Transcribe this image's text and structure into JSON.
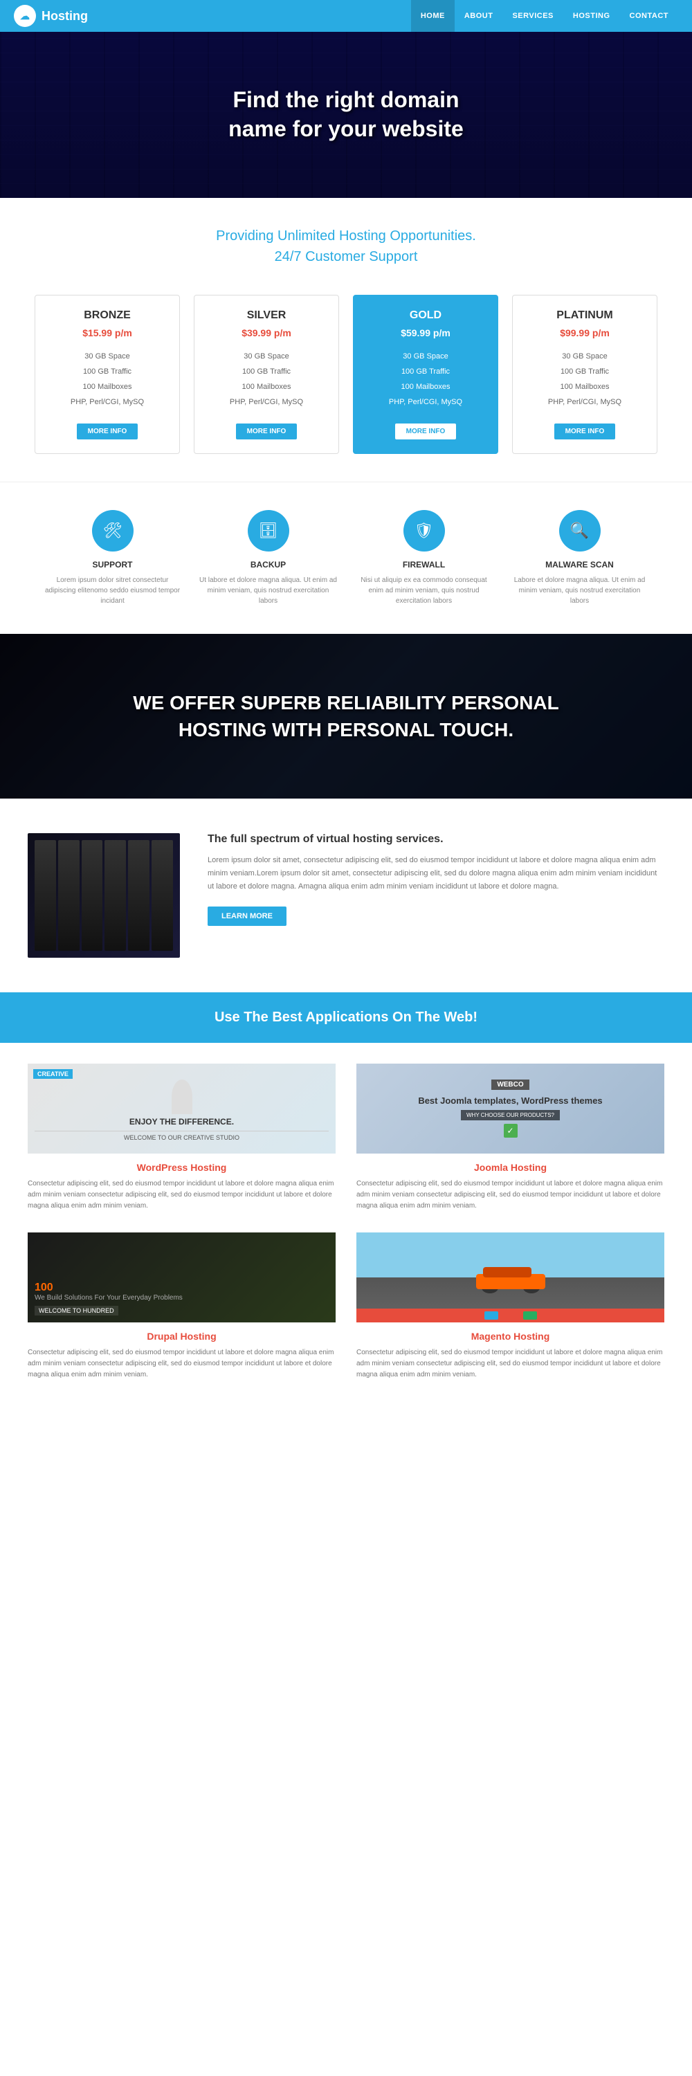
{
  "navbar": {
    "brand": "Hosting",
    "links": [
      {
        "label": "HOME",
        "active": true
      },
      {
        "label": "ABOUT",
        "active": false
      },
      {
        "label": "SERVICES",
        "active": false
      },
      {
        "label": "HOSTING",
        "active": false
      },
      {
        "label": "CONTACT",
        "active": false
      }
    ]
  },
  "hero": {
    "line1": "Find the right domain",
    "line2": "name for your website"
  },
  "tagline": {
    "line1": "Providing Unlimited Hosting Opportunities.",
    "line2": "24/7 Customer Support"
  },
  "pricing": {
    "plans": [
      {
        "name": "BRONZE",
        "price": "$15.99 p/m",
        "features": [
          "30 GB Space",
          "100 GB Traffic",
          "100 Mailboxes",
          "PHP, Perl/CGI, MySQ"
        ],
        "cta": "MORE INFO",
        "featured": false
      },
      {
        "name": "SILVER",
        "price": "$39.99 p/m",
        "features": [
          "30 GB Space",
          "100 GB Traffic",
          "100 Mailboxes",
          "PHP, Perl/CGI, MySQ"
        ],
        "cta": "MORE INFO",
        "featured": false
      },
      {
        "name": "GOLD",
        "price": "$59.99 p/m",
        "features": [
          "30 GB Space",
          "100 GB Traffic",
          "100 Mailboxes",
          "PHP, Perl/CGI, MySQ"
        ],
        "cta": "MORE INFO",
        "featured": true
      },
      {
        "name": "PLATINUM",
        "price": "$99.99 p/m",
        "features": [
          "30 GB Space",
          "100 GB Traffic",
          "100 Mailboxes",
          "PHP, Perl/CGI, MySQ"
        ],
        "cta": "MORE INFO",
        "featured": false
      }
    ]
  },
  "features": [
    {
      "icon": "🛠",
      "name": "SUPPORT",
      "desc": "Lorem ipsum dolor sitret consectetur adipiscing elitenomo seddo eiusmod tempor incidant"
    },
    {
      "icon": "🗄",
      "name": "BACKUP",
      "desc": "Ut labore et dolore magna aliqua. Ut enim ad minim veniam, quis nostrud exercitation labors"
    },
    {
      "icon": "🛡",
      "name": "FIREWALL",
      "desc": "Nisi ut aliquip ex ea commodo consequat enim ad minim veniam, quis nostrud exercitation labors"
    },
    {
      "icon": "🔍",
      "name": "MALWARE SCAN",
      "desc": "Labore et dolore magna aliqua. Ut enim ad minim veniam, quis nostrud exercitation labors"
    }
  ],
  "banner": {
    "line1": "WE OFFER SUPERB RELIABILITY PERSONAL",
    "line2": "HOSTING WITH PERSONAL TOUCH."
  },
  "virtual": {
    "title": "The full spectrum of virtual hosting services.",
    "body": "Lorem ipsum dolor sit amet, consectetur adipiscing elit, sed do eiusmod tempor incididunt ut labore et dolore magna aliqua enim adm minim veniam.Lorem ipsum dolor sit amet, consectetur adipiscing elit, sed du dolore magna aliqua enim adm minim veniam incididunt ut labore et dolore magna. Amagna aliqua enim adm minim veniam incididunt ut labore et dolore magna.",
    "cta": "LEARN MORE"
  },
  "apps": {
    "title": "Use The Best Applications On The Web!",
    "items": [
      {
        "name": "WordPress Hosting",
        "thumbnail_label": "CREATIVE",
        "thumbnail_enjoy": "ENJOY THE DIFFERENCE.",
        "thumbnail_welcome": "WELCOME TO OUR CREATIVE STUDIO",
        "desc": "Consectetur adipiscing elit, sed do eiusmod tempor incididunt ut labore et dolore magna aliqua enim adm minim veniam consectetur adipiscing elit, sed do eiusmod tempor incididunt ut labore et dolore magna aliqua enim adm minim veniam."
      },
      {
        "name": "Joomla Hosting",
        "thumbnail_label": "webco",
        "thumbnail_title": "Best Joomla templates, WordPress themes",
        "thumbnail_why": "WHY CHOOSE OUR PRODUCTS?",
        "desc": "Consectetur adipiscing elit, sed do eiusmod tempor incididunt ut labore et dolore magna aliqua enim adm minim veniam consectetur adipiscing elit, sed do eiusmod tempor incididunt ut labore et dolore magna aliqua enim adm minim veniam."
      },
      {
        "name": "Drupal Hosting",
        "thumbnail_label": "100",
        "thumbnail_tagline": "We Build Solutions For Your Everyday Problems",
        "thumbnail_welcome": "WELCOME TO HUNDRED",
        "desc": "Consectetur adipiscing elit, sed do eiusmod tempor incididunt ut labore et dolore magna aliqua enim adm minim veniam consectetur adipiscing elit, sed do eiusmod tempor incididunt ut labore et dolore magna aliqua enim adm minim veniam."
      },
      {
        "name": "Magento Hosting",
        "desc": "Consectetur adipiscing elit, sed do eiusmod tempor incididunt ut labore et dolore magna aliqua enim adm minim veniam consectetur adipiscing elit, sed do eiusmod tempor incididunt ut labore et dolore magna aliqua enim adm minim veniam."
      }
    ]
  }
}
